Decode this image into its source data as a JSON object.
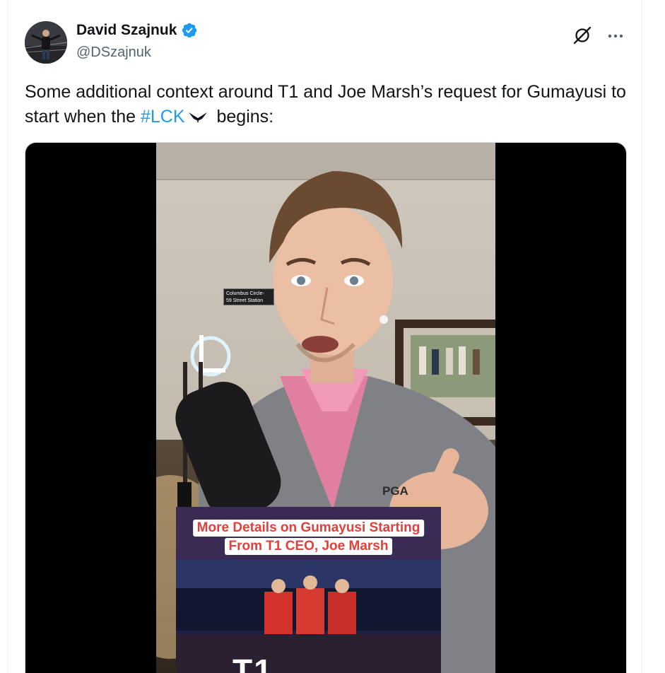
{
  "author": {
    "display_name": "David Szajnuk",
    "handle": "@DSzajnuk",
    "verified": true
  },
  "icons": {
    "verified": "verified-badge-icon",
    "grok": "grok-icon",
    "more": "more-options-icon",
    "hashflag": "lck-hashflag-icon"
  },
  "tweet": {
    "text_part1": "Some additional context around T1 and Joe Marsh’s request for Gumayusi to start when the",
    "hashtag": "#LCK",
    "text_part2": "begins:"
  },
  "video": {
    "caption_line1": "More Details on Gumayusi Starting",
    "caption_line2": "From T1 CEO, Joe Marsh",
    "background_sign_line1": "Columbus Circle-",
    "background_sign_line2": "59 Street Station",
    "shirt_logo": "PGA",
    "bottom_brand": "T1"
  },
  "colors": {
    "link": "#1d9bf0",
    "verified": "#1d9bf0",
    "text_primary": "#0f1419",
    "text_secondary": "#536471",
    "caption_text": "#e0413c"
  }
}
